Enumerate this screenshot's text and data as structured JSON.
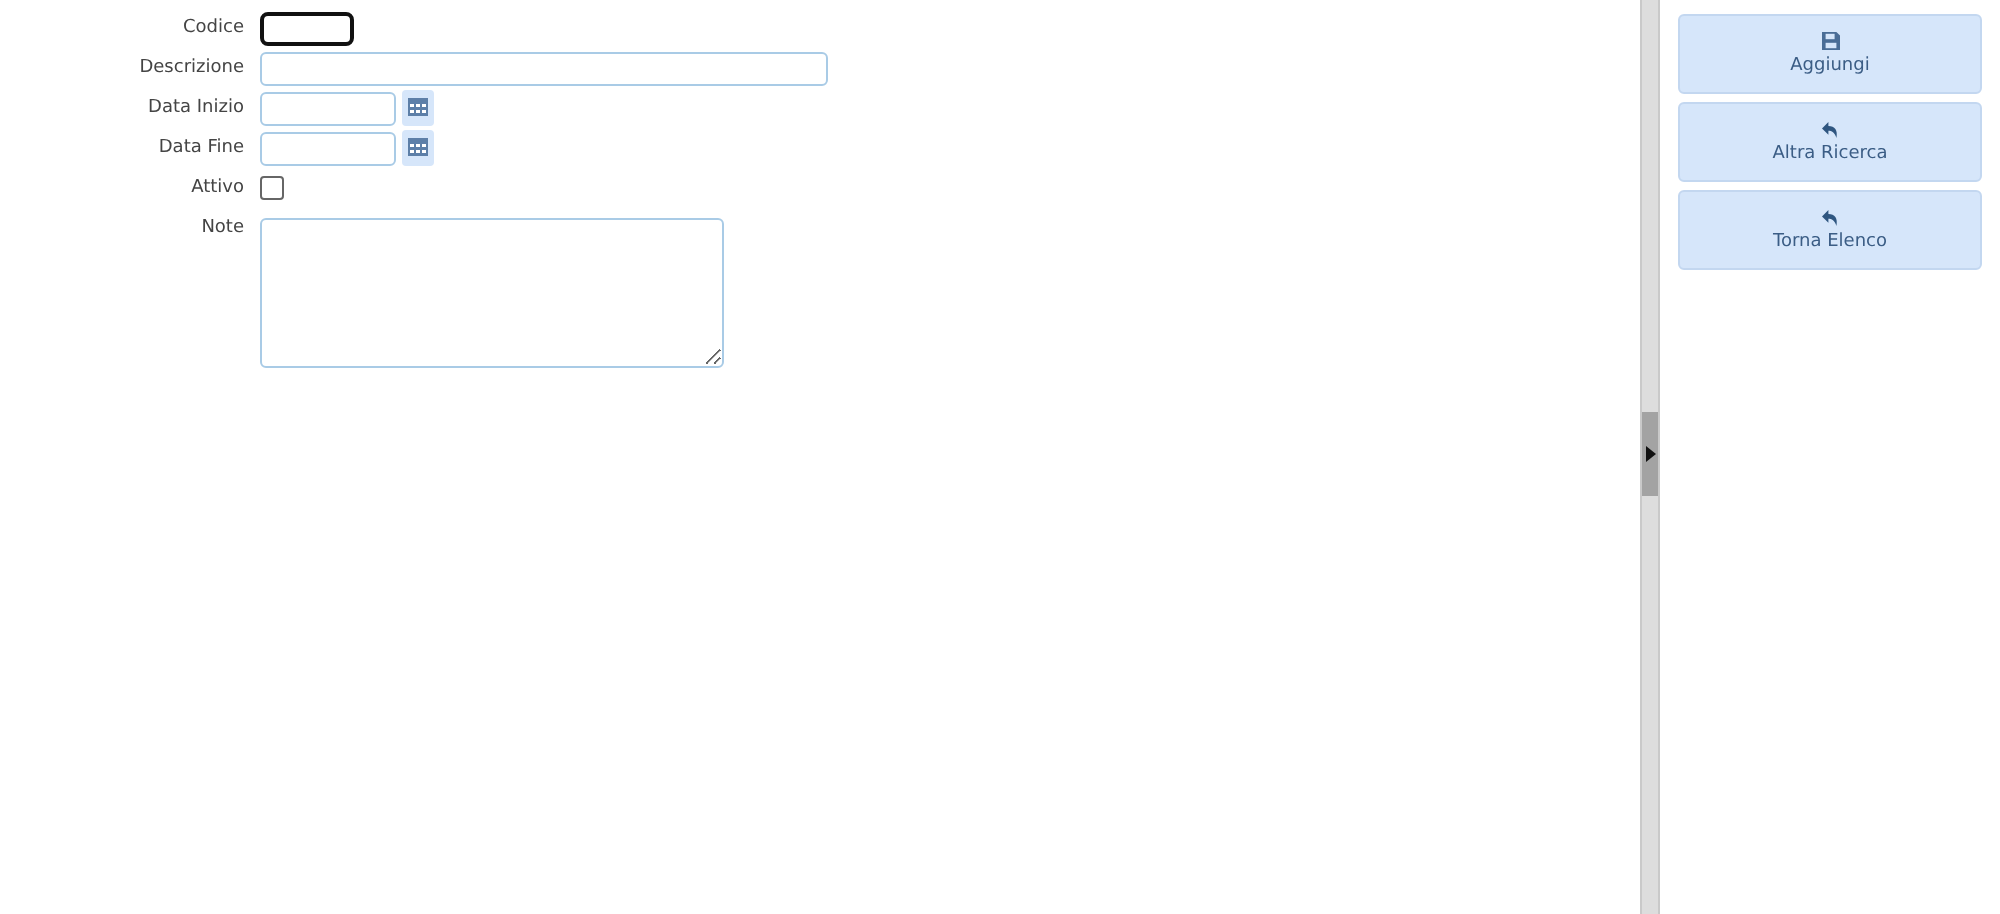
{
  "form": {
    "fields": [
      {
        "label": "Codice",
        "kind": "code",
        "focused": true
      },
      {
        "label": "Descrizione",
        "kind": "text",
        "focused": false
      },
      {
        "label": "Data Inizio",
        "kind": "date",
        "focused": false
      },
      {
        "label": "Data Fine",
        "kind": "date",
        "focused": false
      },
      {
        "label": "Attivo",
        "kind": "checkbox",
        "checked": false
      },
      {
        "label": "Note",
        "kind": "textarea",
        "focused": false
      }
    ]
  },
  "actions": [
    {
      "label": "Aggiungi",
      "kind": "save"
    },
    {
      "label": "Altra Ricerca",
      "kind": "back"
    },
    {
      "label": "Torna Elenco",
      "kind": "back"
    }
  ]
}
